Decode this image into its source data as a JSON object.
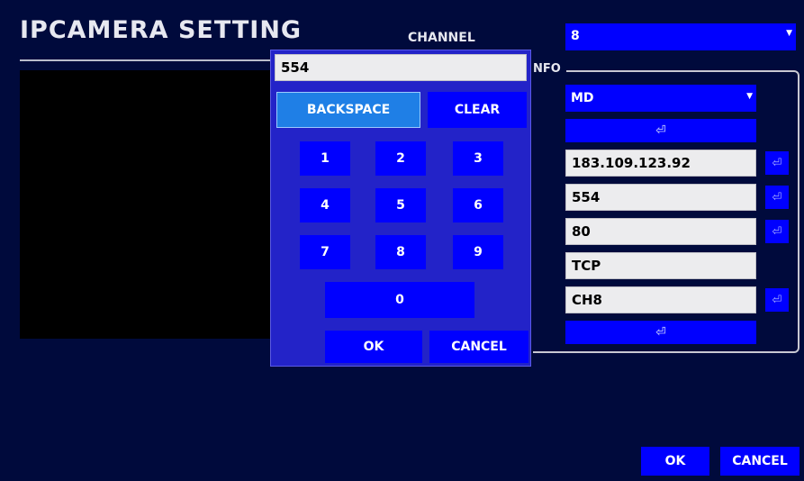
{
  "header": {
    "title": "IPCAMERA  SETTING",
    "channel_label": "CHANNEL",
    "channel_value": "8"
  },
  "info": {
    "legend": "NFO",
    "mode_value": "MD",
    "fields": [
      {
        "value": "183.109.123.92"
      },
      {
        "value": "554"
      },
      {
        "value": "80"
      },
      {
        "value": "TCP"
      },
      {
        "value": "CH8"
      }
    ]
  },
  "keypad": {
    "display_value": "554",
    "backspace_label": "BACKSPACE",
    "clear_label": "CLEAR",
    "keys": [
      "1",
      "2",
      "3",
      "4",
      "5",
      "6",
      "7",
      "8",
      "9",
      "0"
    ],
    "ok_label": "OK",
    "cancel_label": "CANCEL"
  },
  "footer": {
    "ok_label": "OK",
    "cancel_label": "CANCEL"
  },
  "icons": {
    "enter": "enter-icon",
    "dropdown": "chevron-down-icon"
  },
  "colors": {
    "background": "#000a3c",
    "button_blue": "#0000ff",
    "keypad_bg": "#2323c8",
    "backspace_highlight": "#1f7fe6",
    "field_bg": "#ececee"
  }
}
